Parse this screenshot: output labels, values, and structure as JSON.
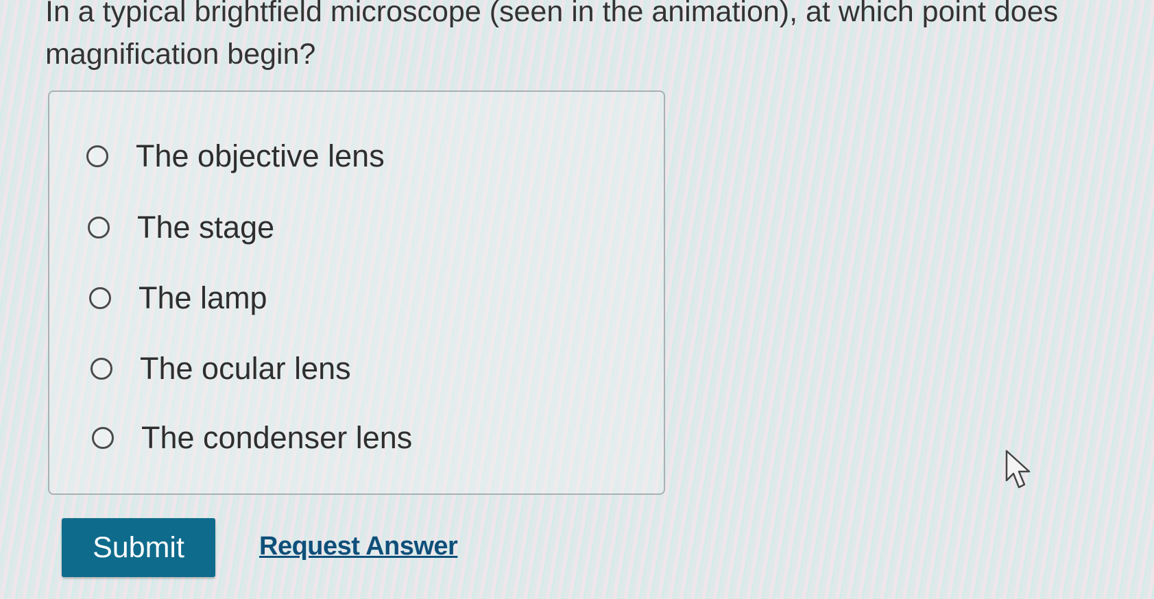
{
  "question": {
    "text": "In a typical brightfield microscope (seen in the animation), at which point does magnification begin?"
  },
  "choices": [
    {
      "label": "The objective lens",
      "selected": false
    },
    {
      "label": "The stage",
      "selected": false
    },
    {
      "label": "The lamp",
      "selected": false
    },
    {
      "label": "The ocular lens",
      "selected": false
    },
    {
      "label": "The condenser lens",
      "selected": false
    }
  ],
  "actions": {
    "submit_label": "Submit",
    "request_answer_label": "Request Answer"
  },
  "colors": {
    "submit_button": "#0f6b8c",
    "link": "#0f4f7a"
  },
  "icons": {
    "cursor": "mouse-pointer-icon"
  }
}
